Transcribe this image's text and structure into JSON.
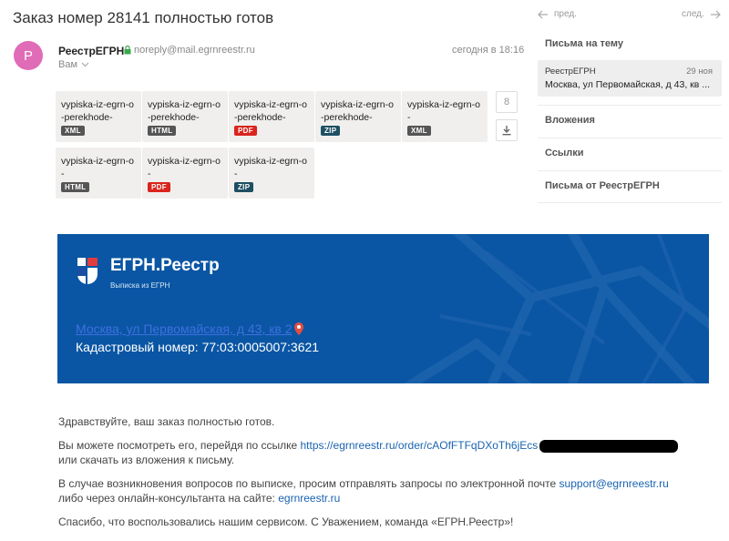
{
  "message": {
    "subject": "Заказ номер 28141 полностью готов",
    "sender_initial": "P",
    "sender_name": "РеестрЕГРН",
    "sender_email": "noreply@mail.egrnreestr.ru",
    "recipient": "Вам",
    "date": "сегодня в 18:16"
  },
  "attachments": [
    {
      "name": "vypiska-iz-egrn-o-perekhode-",
      "type": "XML"
    },
    {
      "name": "vypiska-iz-egrn-o-perekhode-",
      "type": "HTML"
    },
    {
      "name": "vypiska-iz-egrn-o-perekhode-",
      "type": "PDF"
    },
    {
      "name": "vypiska-iz-egrn-o-perekhode-",
      "type": "ZIP"
    },
    {
      "name": "vypiska-iz-egrn-o-",
      "type": "XML"
    },
    {
      "name": "vypiska-iz-egrn-o-",
      "type": "HTML"
    },
    {
      "name": "vypiska-iz-egrn-o-",
      "type": "PDF"
    },
    {
      "name": "vypiska-iz-egrn-o-",
      "type": "ZIP"
    }
  ],
  "attachment_count": "8",
  "badge_colors": {
    "XML": "#555555",
    "HTML": "#555555",
    "PDF": "#d9251d",
    "ZIP": "#1e4f63"
  },
  "nav": {
    "prev": "пред.",
    "next": "след."
  },
  "sidebar": {
    "thread_title": "Письма на тему",
    "thread_item": {
      "sender": "РеестрЕГРН",
      "date": "29 ноя",
      "snippet": "Москва, ул Первомайская, д 43, кв ..."
    },
    "attachments": "Вложения",
    "links": "Ссылки",
    "from_sender": "Письма от РеестрЕГРН"
  },
  "banner": {
    "brand": "ЕГРН.Реестр",
    "tagline": "Выписка из ЕГРН",
    "address": "Москва, ул Первомайская, д 43, кв 2",
    "cadastral": "Кадастровый номер: 77:03:0005007:3621",
    "bg_color": "#0a56a4"
  },
  "body": {
    "greeting": "Здравствуйте, ваш заказ полностью готов.",
    "line1_prefix": "Вы можете посмотреть его, перейдя по ссылке ",
    "order_link": "https://egrnreestr.ru/order/cAOfFTFqDXoTh6jEcs",
    "line1_suffix": "или скачать из вложения к письму.",
    "line2_prefix": "В случае возникновения вопросов по выписке, просим отправлять запросы по электронной почте ",
    "support_email": "support@egrnreestr.ru",
    "line2_mid": "либо через онлайн-консультанта на сайте: ",
    "site_link": "egrnreestr.ru",
    "thanks": "Спасибо, что воспользовались нашим сервисом. С Уважением, команда «ЕГРН.Реестр»!"
  }
}
